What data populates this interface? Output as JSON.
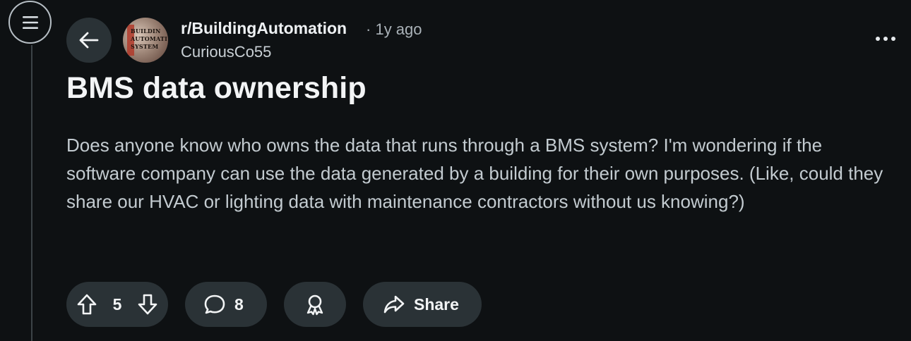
{
  "post": {
    "subreddit": "r/BuildingAutomation",
    "age": "1y ago",
    "author": "CuriousCo55",
    "title": "BMS data ownership",
    "body": "Does anyone know who owns the data that runs through a BMS system? I'm wondering if the software company can use the data generated by a building for their own purposes. (Like, could they share our HVAC or lighting data with maintenance contractors without us knowing?)"
  },
  "avatar": {
    "lines": [
      "BUILDIN",
      "AUTOMATI",
      "SYSTEM"
    ]
  },
  "actions": {
    "score": "5",
    "comments": "8",
    "share_label": "Share"
  },
  "icons": {
    "menu": "hamburger-menu-icon",
    "back": "arrow-left-icon",
    "more": "more-horizontal-icon",
    "upvote": "arrow-up-outline-icon",
    "downvote": "arrow-down-outline-icon",
    "comment": "speech-bubble-icon",
    "award": "award-ribbon-icon",
    "share": "share-arrow-icon"
  },
  "colors": {
    "background": "#0e1113",
    "pill": "#2a3236",
    "text": "#eef1f3",
    "muted": "#aab2b8"
  }
}
